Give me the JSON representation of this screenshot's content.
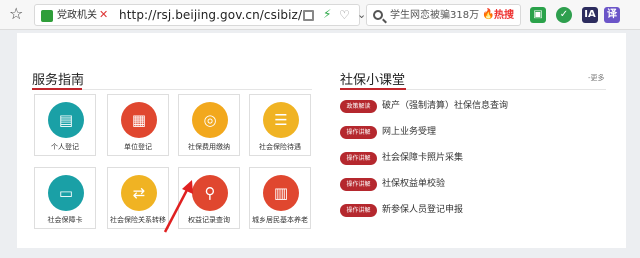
{
  "toolbar": {
    "star_glyph": "☆",
    "site_label": "党政机关",
    "url": "http://rsj.beijing.gov.cn/csibiz/",
    "search_text": "学生网恋被骗318万",
    "hot_label": "热搜",
    "ext_ia_label": "IA",
    "ext_translate_label": "译"
  },
  "services": {
    "title": "服务指南",
    "tiles": [
      {
        "label": "个人登记",
        "icon": "id-card-icon",
        "color": "#1aa0a6",
        "glyph": "▤"
      },
      {
        "label": "单位登记",
        "icon": "building-icon",
        "color": "#e0472f",
        "glyph": "▦"
      },
      {
        "label": "社保费用缴纳",
        "icon": "coins-icon",
        "color": "#f2a81d",
        "glyph": "◎"
      },
      {
        "label": "社会保险待遇",
        "icon": "document-list-icon",
        "color": "#f0b323",
        "glyph": "☰"
      },
      {
        "label": "社会保障卡",
        "icon": "social-card-icon",
        "color": "#1aa0a6",
        "glyph": "▭"
      },
      {
        "label": "社会保险关系转移",
        "icon": "transfer-icon",
        "color": "#f0b323",
        "glyph": "⇄"
      },
      {
        "label": "权益记录查询",
        "icon": "magnifier-icon",
        "color": "#e0472f",
        "glyph": "⚲"
      },
      {
        "label": "城乡居民基本养老",
        "icon": "pension-icon",
        "color": "#e0472f",
        "glyph": "▥"
      }
    ]
  },
  "classroom": {
    "title": "社保小课堂",
    "more": "更多",
    "items": [
      {
        "badge": "政策解读",
        "text": "破产（强制清算）社保信息查询"
      },
      {
        "badge": "操作讲解",
        "text": "网上业务受理"
      },
      {
        "badge": "操作讲解",
        "text": "社会保障卡照片采集"
      },
      {
        "badge": "操作讲解",
        "text": "社保权益单校验"
      },
      {
        "badge": "操作讲解",
        "text": "新参保人员登记申报"
      }
    ]
  }
}
